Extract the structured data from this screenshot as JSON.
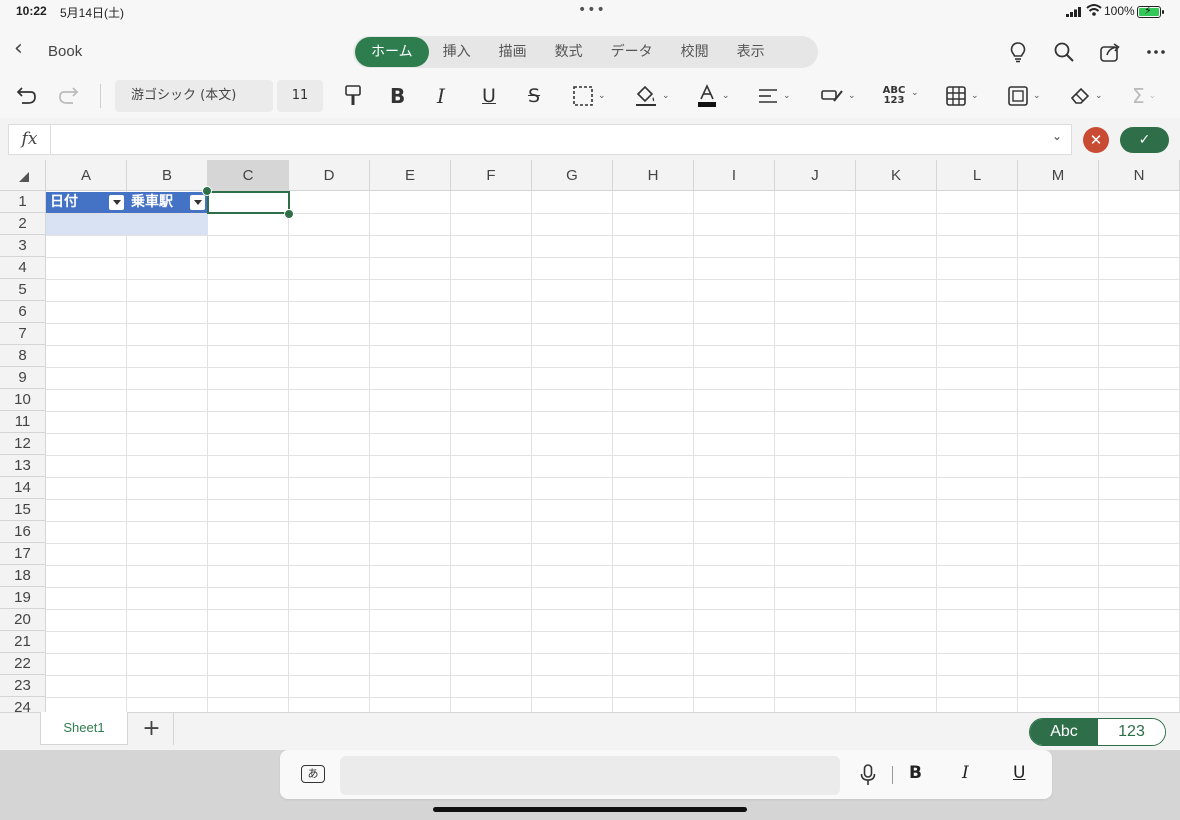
{
  "status_bar": {
    "time": "10:22",
    "date": "5月14日(土)",
    "dots": "•••",
    "battery": "100%"
  },
  "header": {
    "doc_title": "Book",
    "tabs": [
      {
        "label": "ホーム",
        "active": true
      },
      {
        "label": "挿入"
      },
      {
        "label": "描画"
      },
      {
        "label": "数式"
      },
      {
        "label": "データ"
      },
      {
        "label": "校閲"
      },
      {
        "label": "表示"
      }
    ],
    "icons": [
      "lightbulb-icon",
      "search-icon",
      "share-icon",
      "more-icon"
    ]
  },
  "ribbon": {
    "font_name": "游ゴシック (本文)",
    "font_size": "11",
    "abc_label": "ABC",
    "num_label": "123"
  },
  "formula_bar": {
    "fx_label": "fx",
    "value": ""
  },
  "grid": {
    "columns": [
      "A",
      "B",
      "C",
      "D",
      "E",
      "F",
      "G",
      "H",
      "I",
      "J",
      "K",
      "L",
      "M",
      "N"
    ],
    "selected_column": "C",
    "rows": [
      "1",
      "2",
      "3",
      "4",
      "5",
      "6",
      "7",
      "8",
      "9",
      "10",
      "11",
      "12",
      "13",
      "14",
      "15",
      "16",
      "17",
      "18",
      "19",
      "20",
      "21",
      "22",
      "23",
      "24"
    ],
    "selected_cell": "C1",
    "table_headers": [
      "日付",
      "乗車駅"
    ]
  },
  "sheet_tabs": {
    "sheets": [
      "Sheet1"
    ],
    "add_label": "+",
    "keyboard_toggle": {
      "abc": "Abc",
      "num": "123",
      "active": "abc"
    }
  },
  "keyboard_bar": {
    "ime_label": "あ",
    "bold": "B",
    "italic": "I",
    "underline": "U"
  },
  "colors": {
    "accent_green": "#2e7d4f",
    "table_header_blue": "#4472c4",
    "table_row_blue": "#d9e2f3",
    "cancel_red": "#c84b34"
  }
}
